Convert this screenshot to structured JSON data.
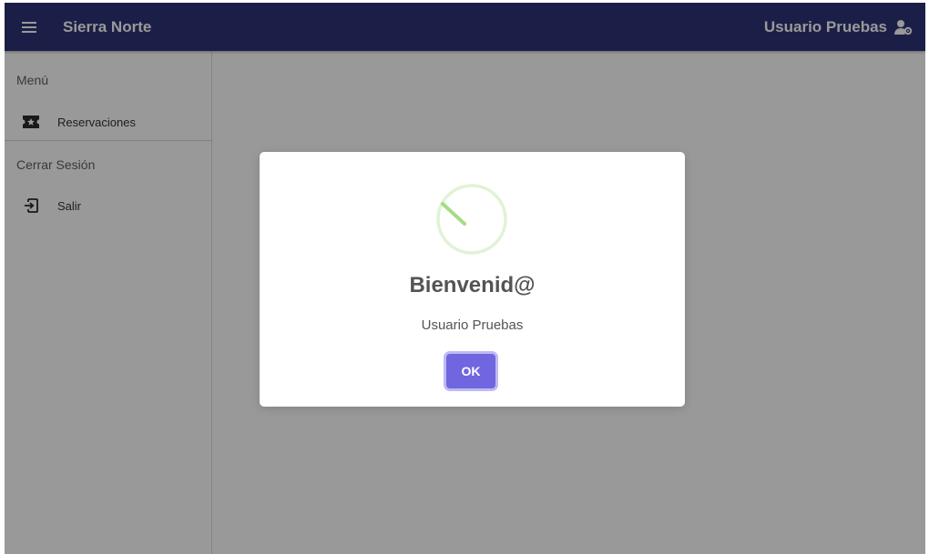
{
  "topbar": {
    "title": "Sierra Norte",
    "user_name": "Usuario Pruebas",
    "menu_icon": "hamburger-icon",
    "user_icon": "user-gear-icon",
    "background_color": "#2e3577"
  },
  "sidebar": {
    "sections": [
      {
        "header": "Menú",
        "items": [
          {
            "label": "Reservaciones",
            "icon": "ticket-star-icon"
          }
        ]
      },
      {
        "header": "Cerrar Sesión",
        "items": [
          {
            "label": "Salir",
            "icon": "logout-icon"
          }
        ]
      }
    ]
  },
  "modal": {
    "icon": "success-check-icon",
    "title": "Bienvenid@",
    "text": "Usuario Pruebas",
    "ok_label": "OK",
    "button_color": "#7066e0",
    "icon_color": "#a5dc86"
  }
}
